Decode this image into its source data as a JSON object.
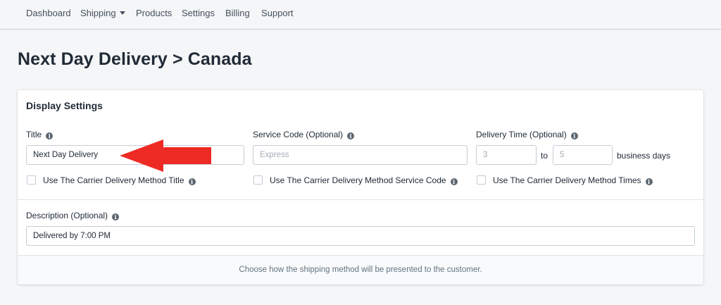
{
  "nav": {
    "items": [
      "Dashboard",
      "Shipping",
      "Products",
      "Settings",
      "Billing",
      "Support"
    ]
  },
  "page": {
    "title": "Next Day Delivery > Canada"
  },
  "card": {
    "title": "Display Settings",
    "title_field": {
      "label": "Title",
      "value": "Next Day Delivery",
      "checkbox_label": "Use The Carrier Delivery Method Title"
    },
    "service_code": {
      "label": "Service Code (Optional)",
      "placeholder": "Express",
      "checkbox_label": "Use The Carrier Delivery Method Service Code"
    },
    "delivery_time": {
      "label": "Delivery Time (Optional)",
      "min_placeholder": "3",
      "to_label": "to",
      "max_placeholder": "5",
      "unit_label": "business days",
      "checkbox_label": "Use The Carrier Delivery Method Times"
    },
    "description": {
      "label": "Description (Optional)",
      "value": "Delivered by 7:00 PM"
    },
    "footer_text": "Choose how the shipping method will be presented to the customer."
  },
  "info_icon_glyph": "i",
  "colors": {
    "annotation_arrow": "#ee2a24"
  }
}
